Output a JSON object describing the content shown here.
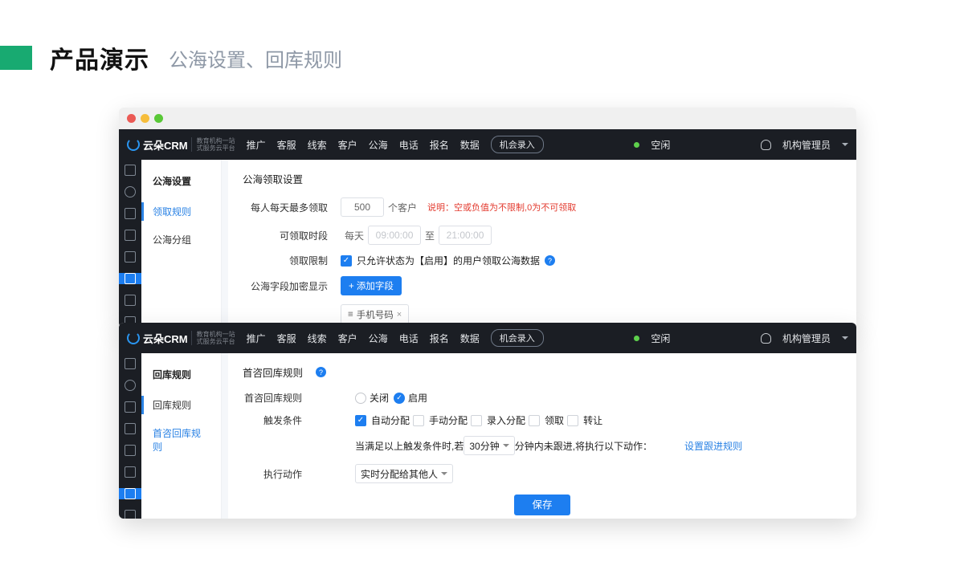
{
  "slide": {
    "title": "产品演示",
    "subtitle": "公海设置、回库规则"
  },
  "nav": {
    "brand": "云朵CRM",
    "brand_sub1": "教育机构一站",
    "brand_sub2": "式服务云平台",
    "items": [
      "推广",
      "客服",
      "线索",
      "客户",
      "公海",
      "电话",
      "报名",
      "数据"
    ],
    "btn": "机会录入",
    "status": "空闲",
    "user": "机构管理员"
  },
  "panel1": {
    "sidebar_title": "公海设置",
    "menu": [
      "领取规则",
      "公海分组"
    ],
    "section": "公海领取设置",
    "rows": {
      "limit_label": "每人每天最多领取",
      "limit_value": "500",
      "limit_suffix": "个客户",
      "limit_note": "说明：空或负值为不限制,0为不可领取",
      "time_label": "可领取时段",
      "time_daily": "每天",
      "time_from": "09:00:00",
      "time_sep": "至",
      "time_to": "21:00:00",
      "restrict_label": "领取限制",
      "restrict_text": "只允许状态为【启用】的用户领取公海数据",
      "mask_label": "公海字段加密显示",
      "add_btn": "+ 添加字段",
      "chip_prefix": "≡",
      "chip_text": "手机号码",
      "chip_x": "×"
    }
  },
  "panel2": {
    "sidebar_title": "回库规则",
    "menu": [
      "回库规则",
      "首咨回库规则"
    ],
    "section": "首咨回库规则",
    "help": "?",
    "rows": {
      "rule_label": "首咨回库规则",
      "off": "关闭",
      "on": "启用",
      "trigger_label": "触发条件",
      "c1": "自动分配",
      "c2": "手动分配",
      "c3": "录入分配",
      "c4": "领取",
      "c5": "转让",
      "cond_pre": "当满足以上触发条件时,若",
      "cond_sel": "30分钟",
      "cond_post": "分钟内未跟进,将执行以下动作：",
      "link": "设置跟进规则",
      "action_label": "执行动作",
      "action_sel": "实时分配给其他人",
      "save": "保存"
    }
  }
}
